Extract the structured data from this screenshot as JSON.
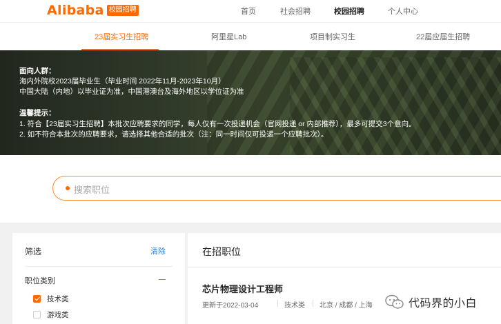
{
  "header": {
    "logo_text": "Alibaba",
    "logo_badge": "校园招聘",
    "nav": [
      "首页",
      "社会招聘",
      "校园招聘",
      "个人中心"
    ]
  },
  "subnav": {
    "tabs": [
      "23届实习生招聘",
      "阿里星Lab",
      "项目制实习生",
      "22届应届生招聘"
    ]
  },
  "banner": {
    "audience_heading": "面向人群：",
    "audience_lines": [
      "海内外院校2023届毕业生（毕业时间 2022年11月-2023年10月）",
      "中国大陆（内地）以毕业证为准，中国港澳台及海外地区以学位证为准"
    ],
    "tips_heading": "温馨提示：",
    "tips_lines": [
      "1. 符合【23届实习生招聘】本批次应聘要求的同学，每人仅有一次投递机会（官网投递 or 内部推荐），最多可提交3个意向。",
      "2. 如不符合本批次的应聘要求，请选择其他合适的批次（注：同一时间仅可投递一个应聘批次）。"
    ]
  },
  "search": {
    "placeholder": "搜索职位"
  },
  "filter": {
    "title": "筛选",
    "clear_label": "清除",
    "category_label": "职位类别",
    "options": [
      {
        "label": "技术类",
        "checked": true
      },
      {
        "label": "游戏类",
        "checked": false
      }
    ]
  },
  "jobs": {
    "heading": "在招职位",
    "items": [
      {
        "title": "芯片物理设计工程师",
        "updated": "更新于2022-03-04",
        "category": "技术类",
        "locations": "北京 / 成都 / 上海"
      }
    ]
  },
  "watermark": {
    "text": "代码界的小白",
    "icon": "wechat-official-account-icon"
  },
  "colors": {
    "accent": "#ff6a00",
    "link": "#2a7fd4"
  }
}
